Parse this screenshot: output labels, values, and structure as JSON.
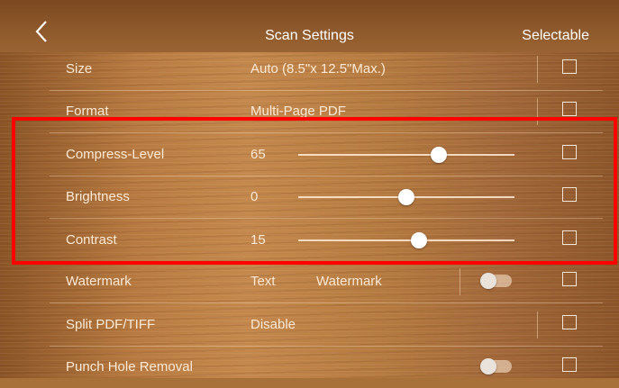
{
  "header": {
    "title": "Scan Settings",
    "right_label": "Selectable"
  },
  "settings": {
    "size": {
      "label": "Size",
      "value": "Auto (8.5\"x 12.5\"Max.)",
      "selected": false
    },
    "format": {
      "label": "Format",
      "value": "Multi-Page PDF",
      "selected": false
    },
    "compress": {
      "label": "Compress-Level",
      "value": "65",
      "slider_fraction": 0.65,
      "selected": false
    },
    "brightness": {
      "label": "Brightness",
      "value": "0",
      "slider_fraction": 0.5,
      "selected": false
    },
    "contrast": {
      "label": "Contrast",
      "value": "15",
      "slider_fraction": 0.56,
      "selected": false
    },
    "watermark": {
      "label": "Watermark",
      "value": "Text",
      "value2": "Watermark",
      "toggle_on": false,
      "selected": false
    },
    "split": {
      "label": "Split PDF/TIFF",
      "value": "Disable",
      "selected": false
    },
    "punch": {
      "label": "Punch Hole Removal",
      "toggle_on": false,
      "selected": false
    }
  },
  "colors": {
    "highlight": "#ff0000",
    "text": "#fbe9d4"
  }
}
